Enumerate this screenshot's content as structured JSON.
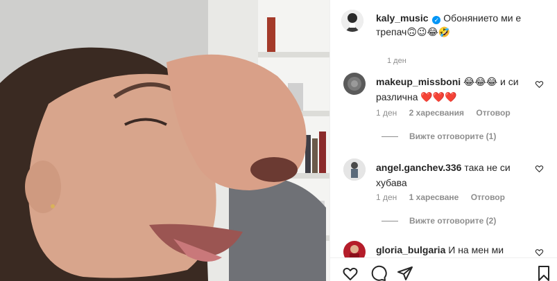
{
  "post": {
    "author": "kaly_music",
    "verified": true,
    "caption_text": "Обонянието ми е трепач🙃😉😂🤣",
    "time": "1 ден"
  },
  "comments": [
    {
      "username": "makeup_missboni",
      "text": "😂😂😂 и си различна ❤️❤️❤️",
      "time": "1 ден",
      "likes": "2 харесвания",
      "reply_label": "Отговор",
      "view_replies": "Вижте отговорите (1)"
    },
    {
      "username": "angel.ganchev.336",
      "text": "така не си хубава",
      "time": "1 ден",
      "likes": "1 харесване",
      "reply_label": "Отговор",
      "view_replies": "Вижте отговорите (2)"
    },
    {
      "username": "gloria_bulgaria",
      "text": "И на мен ми"
    }
  ],
  "icons": {
    "like": "heart-icon",
    "comment": "comment-icon",
    "share": "share-icon",
    "save": "bookmark-icon",
    "comment_like": "heart-icon"
  },
  "colors": {
    "verified_blue": "#0095f6",
    "secondary_text": "#8e8e8e",
    "primary_text": "#262626",
    "heart_red": "#ed4956"
  }
}
